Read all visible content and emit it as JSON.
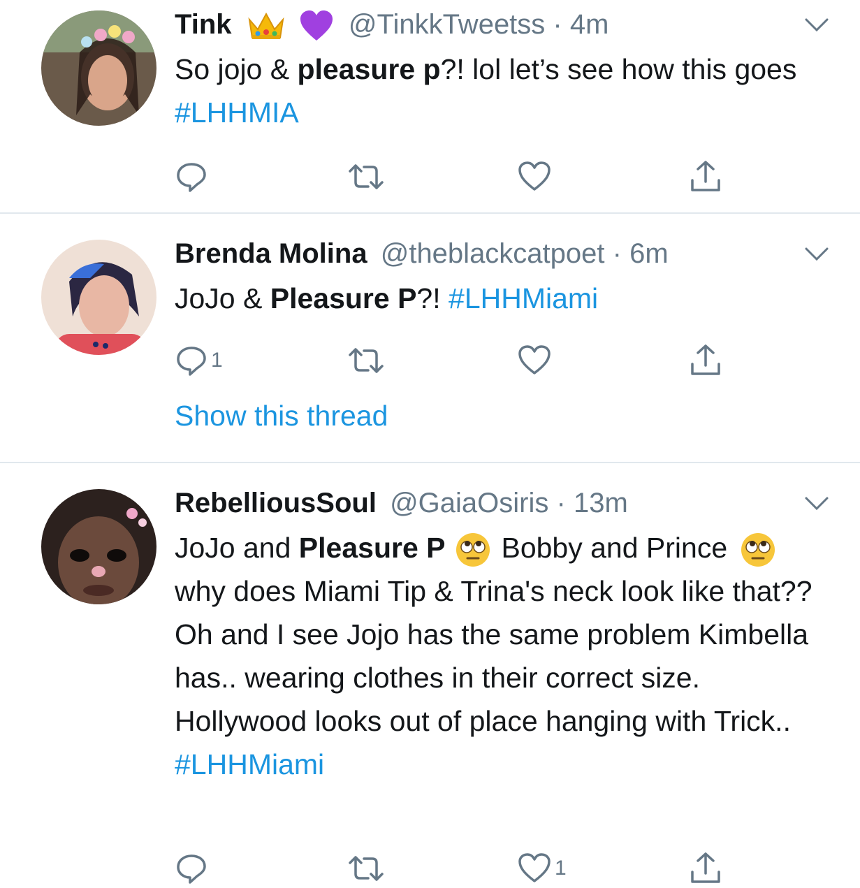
{
  "tweets": [
    {
      "name": "Tink",
      "handle": "@TinkkTweetss",
      "dot": "·",
      "time": "4m",
      "text_parts": [
        "So jojo & ",
        "pleasure p",
        "?! lol let’s see how this goes "
      ],
      "hashtag": "#LHHMIA",
      "reply_count": "",
      "like_count": "",
      "avatar_colors": [
        "#6a5a4a",
        "#d9a58a",
        "#2a1c16"
      ]
    },
    {
      "name": "Brenda Molina",
      "handle": "@theblackcatpoet",
      "dot": "·",
      "time": "6m",
      "text_parts": [
        "JoJo & ",
        "Pleasure P",
        "?! "
      ],
      "hashtag": "#LHHMiami",
      "reply_count": "1",
      "like_count": "",
      "show_thread": "Show this thread",
      "avatar_colors": [
        "#efe0d6",
        "#e8b7a4",
        "#2b2742"
      ]
    },
    {
      "name": "RebelliousSoul",
      "handle": "@GaiaOsiris",
      "dot": "·",
      "time": "13m",
      "text_parts": [
        "JoJo and ",
        "Pleasure P",
        "Bobby and Prince",
        "why does Miami Tip & Trina's neck look like that?? Oh and I see Jojo has the same problem Kimbella has.. wearing clothes in their correct size. Hollywood looks out of place hanging with Trick.."
      ],
      "hashtag": "#LHHMiami",
      "reply_count": "",
      "like_count": "1",
      "avatar_colors": [
        "#2c211e",
        "#6b4a3c",
        "#0f0b0a"
      ]
    }
  ],
  "icons": {
    "reply": "reply-icon",
    "retweet": "retweet-icon",
    "like": "heart-icon",
    "share": "share-icon",
    "menu": "chevron-down-icon",
    "emoji_crown": "crown-emoji",
    "emoji_heart": "purple-heart-emoji",
    "emoji_eyes": "rolling-eyes-emoji"
  },
  "colors": {
    "link": "#1b95e0",
    "secondary_text": "#657786",
    "icon": "#657786",
    "divider": "#e1e8ed"
  }
}
